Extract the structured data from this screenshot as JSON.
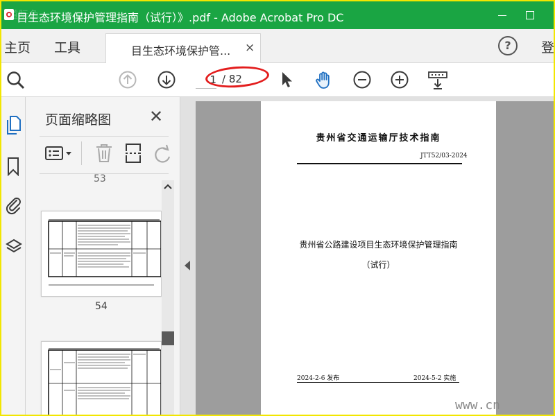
{
  "window": {
    "title": "目生态环境保护管理指南（试行）》.pdf - Adobe Acrobat Pro DC",
    "overlay_watermark": "道阮色"
  },
  "tabs": {
    "home_label": "主页",
    "tools_label": "工具",
    "document_tab_label": "目生态环境保护管...",
    "close_glyph": "×",
    "help_glyph": "?",
    "login_label": "登"
  },
  "toolbar": {
    "current_page": "1",
    "total_pages": "/ 82"
  },
  "thumbnail_panel": {
    "title": "页面缩略图",
    "close_glyph": "✕",
    "partial_page_label": "53",
    "page_label": "54"
  },
  "document": {
    "header": "贵州省交通运输厅技术指南",
    "code": "JTT52/03-2024",
    "title_line1": "贵州省公路建设项目生态环境保护管理指南",
    "title_line2": "（试行）",
    "publish_date": "2024-2-6 发布",
    "effective_date": "2024-5-2 实施"
  },
  "watermark_text": "www.cn",
  "colors": {
    "titlebar": "#1aa543",
    "annotation": "#e31d1d",
    "frame_border": "#f2e600"
  },
  "icons": [
    "app-icon",
    "search-icon",
    "arrow-up-icon",
    "arrow-down-icon",
    "cursor-icon",
    "hand-icon",
    "zoom-out-icon",
    "zoom-in-icon",
    "scroll-mode-icon",
    "pages-icon",
    "bookmark-icon",
    "attachment-icon",
    "layers-icon",
    "options-icon",
    "trash-icon",
    "rotate-icon",
    "extract-icon"
  ]
}
